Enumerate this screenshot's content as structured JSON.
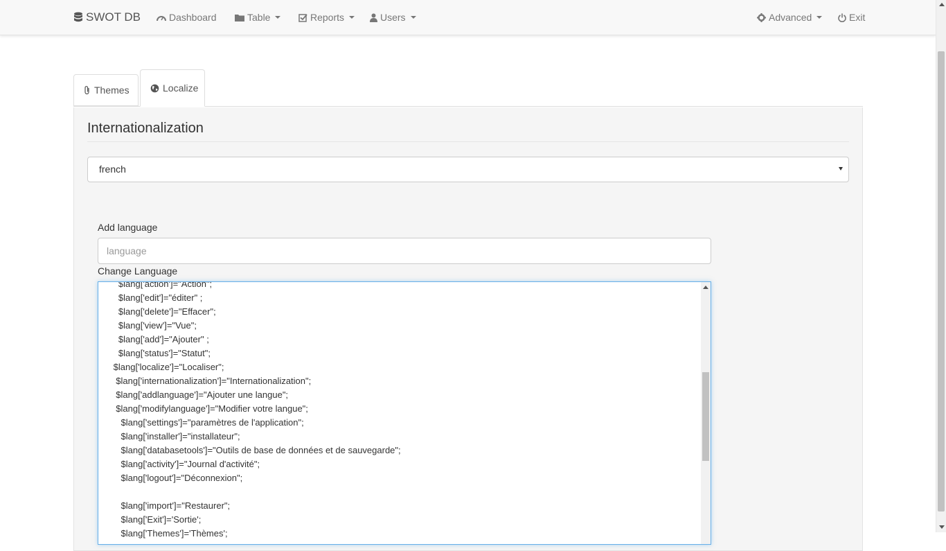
{
  "navbar": {
    "brand": "SWOT DB",
    "items": [
      {
        "label": "Dashboard",
        "icon": "dashboard-icon",
        "dropdown": false
      },
      {
        "label": "Table",
        "icon": "folder-icon",
        "dropdown": true
      },
      {
        "label": "Reports",
        "icon": "check-square-icon",
        "dropdown": true
      },
      {
        "label": "Users",
        "icon": "user-icon",
        "dropdown": true
      },
      {
        "label": "Advanced",
        "icon": "gear-icon",
        "dropdown": true
      },
      {
        "label": "Exit",
        "icon": "power-icon",
        "dropdown": false
      }
    ]
  },
  "tabs": [
    {
      "label": "Themes",
      "icon": "paperclip-icon",
      "active": false
    },
    {
      "label": "Localize",
      "icon": "globe-icon",
      "active": true
    }
  ],
  "panel": {
    "title": "Internationalization",
    "language_select": {
      "value": "french"
    },
    "add_language": {
      "label": "Add language",
      "placeholder": "language",
      "value": ""
    },
    "change_language": {
      "label": "Change Language"
    }
  },
  "editor": {
    "lines": [
      "        $lang['action']=\"Action\";",
      "        $lang['edit']=\"éditer\" ;",
      "        $lang['delete']=\"Effacer\";",
      "        $lang['view']=\"Vue\";",
      "        $lang['add']=\"Ajouter\" ;",
      "        $lang['status']=\"Statut\";",
      "      $lang['localize']=\"Localiser\";",
      "       $lang['internationalization']=\"Internationalization\";",
      "       $lang['addlanguage']=\"Ajouter une langue\";",
      "       $lang['modifylanguage']=\"Modifier votre langue\";",
      "         $lang['settings']=\"paramètres de l'application\";",
      "         $lang['installer']=\"installateur\";",
      "         $lang['databasetools']=\"Outils de base de données et de sauvegarde\";",
      "         $lang['activity']=\"Journal d'activité\";",
      "         $lang['logout']=\"Déconnexion\";",
      "",
      "         $lang['import']=\"Restaurer\";",
      "         $lang['Exit']='Sortie';",
      "         $lang['Themes']='Thèmes';"
    ]
  }
}
